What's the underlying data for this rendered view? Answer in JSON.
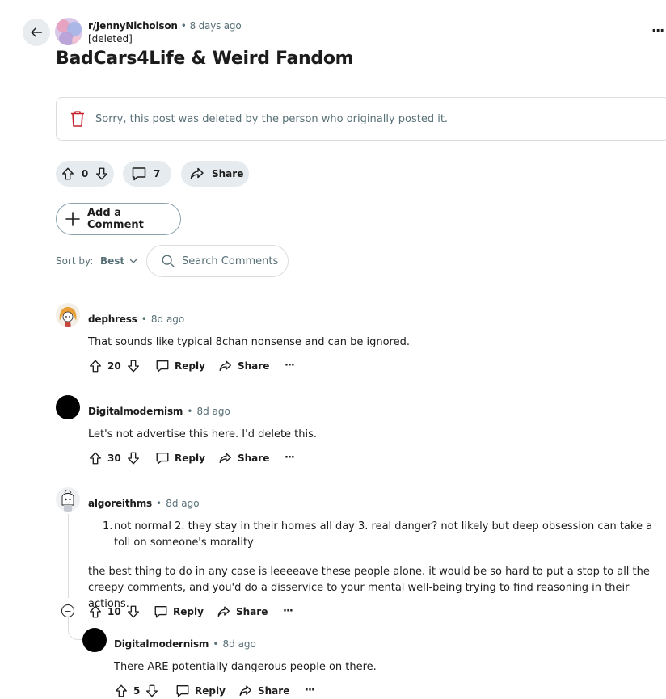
{
  "post": {
    "subreddit": "r/JennyNicholson",
    "dot": "•",
    "time_ago": "8 days ago",
    "author": "[deleted]",
    "more": "···",
    "title": "BadCars4Life & Weird Fandom",
    "deleted_message": "Sorry, this post was deleted by the person who originally posted it.",
    "vote_count": "0",
    "comment_count": "7",
    "share_label": "Share"
  },
  "add_comment_label": "Add a Comment",
  "sort": {
    "label": "Sort by:",
    "value": "Best"
  },
  "search": {
    "placeholder": "Search Comments"
  },
  "comments": [
    {
      "user": "dephress",
      "dot": "•",
      "time": "8d ago",
      "body": "That sounds like typical 8chan nonsense and can be ignored.",
      "votes": "20",
      "reply": "Reply",
      "share": "Share",
      "more": "···"
    },
    {
      "user": "Digitalmodernism",
      "dot": "•",
      "time": "8d ago",
      "body": "Let's not advertise this here. I'd delete this.",
      "votes": "30",
      "reply": "Reply",
      "share": "Share",
      "more": "···"
    },
    {
      "user": "algoreithms",
      "dot": "•",
      "time": "8d ago",
      "list_number": "1.",
      "list_item": "not normal 2. they stay in their homes all day 3. real danger? not likely but deep obsession can take a toll on someone's morality",
      "body": "the best thing to do in any case is leeeeave these people alone. it would be so hard to put a stop to all the creepy comments, and you'd do a disservice to your mental well-being trying to find reasoning in their actions.",
      "votes": "10",
      "reply": "Reply",
      "share": "Share",
      "more": "···",
      "collapse": "−"
    },
    {
      "user": "Digitalmodernism",
      "dot": "•",
      "time": "8d ago",
      "body": "There ARE potentially dangerous people on there.",
      "votes": "5",
      "reply": "Reply",
      "share": "Share",
      "more": "···"
    }
  ],
  "colors": {
    "text": "#1c1c1c",
    "muted": "#576f76",
    "pill_bg": "#e5ebee",
    "deleted_icon": "#c4232c"
  }
}
